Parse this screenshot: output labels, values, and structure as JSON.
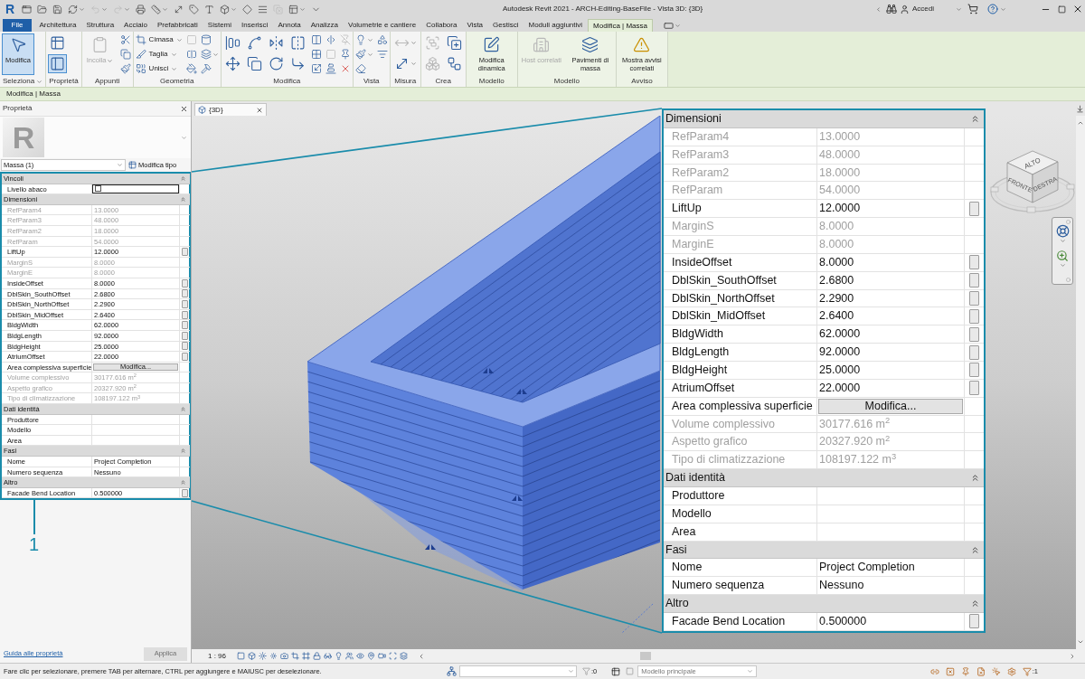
{
  "title_bar": {
    "logo": "R",
    "title": "Autodesk Revit 2021 - ARCH-Editing-BaseFile - Vista 3D: {3D}",
    "user": "Accedi"
  },
  "quick_access": [
    {
      "kind": "home",
      "disabled": false,
      "dropdown": false
    },
    {
      "kind": "open",
      "disabled": false,
      "dropdown": false
    },
    {
      "kind": "save",
      "disabled": false,
      "dropdown": false
    },
    {
      "kind": "sync",
      "disabled": false,
      "dropdown": true
    },
    {
      "kind": "undo",
      "disabled": true,
      "dropdown": true
    },
    {
      "kind": "redo",
      "disabled": true,
      "dropdown": true
    },
    {
      "kind": "print",
      "disabled": false,
      "dropdown": false
    },
    {
      "kind": "measure",
      "disabled": false,
      "dropdown": true
    },
    {
      "kind": "dimension",
      "disabled": false,
      "dropdown": false
    },
    {
      "kind": "tag",
      "disabled": false,
      "dropdown": false
    },
    {
      "kind": "text",
      "disabled": false,
      "dropdown": false
    },
    {
      "kind": "view3d",
      "disabled": false,
      "dropdown": true
    },
    {
      "kind": "section",
      "disabled": false,
      "dropdown": false
    },
    {
      "kind": "thinlines",
      "disabled": false,
      "dropdown": false
    },
    {
      "kind": "closewindows",
      "disabled": true,
      "dropdown": false
    },
    {
      "kind": "switchwindows",
      "disabled": false,
      "dropdown": true
    },
    {
      "kind": "customize",
      "disabled": false,
      "dropdown": false
    }
  ],
  "ribbon_tabs": [
    {
      "label": "File",
      "kind": "file",
      "selected": false
    },
    {
      "label": "Architettura",
      "kind": "tab",
      "selected": false
    },
    {
      "label": "Struttura",
      "kind": "tab",
      "selected": false
    },
    {
      "label": "Acciaio",
      "kind": "tab",
      "selected": false
    },
    {
      "label": "Prefabbricati",
      "kind": "tab",
      "selected": false
    },
    {
      "label": "Sistemi",
      "kind": "tab",
      "selected": false
    },
    {
      "label": "Inserisci",
      "kind": "tab",
      "selected": false
    },
    {
      "label": "Annota",
      "kind": "tab",
      "selected": false
    },
    {
      "label": "Analizza",
      "kind": "tab",
      "selected": false
    },
    {
      "label": "Volumetrie e cantiere",
      "kind": "tab",
      "selected": false
    },
    {
      "label": "Collabora",
      "kind": "tab",
      "selected": false
    },
    {
      "label": "Vista",
      "kind": "tab",
      "selected": false
    },
    {
      "label": "Gestisci",
      "kind": "tab",
      "selected": false
    },
    {
      "label": "Moduli aggiuntivi",
      "kind": "tab",
      "selected": false
    },
    {
      "label": "Modifica | Massa",
      "kind": "context",
      "selected": true
    }
  ],
  "ribbon_panels": [
    {
      "label": "Seleziona",
      "dropdown": true,
      "contextual": false,
      "large": [
        {
          "kind": "select",
          "label": "Modifica",
          "selected": true,
          "disabled": false,
          "dropdown": false
        }
      ]
    },
    {
      "label": "Proprietà",
      "dropdown": false,
      "contextual": false,
      "stacked": [
        {
          "kind": "type_properties",
          "selected": false,
          "disabled": false,
          "dropdown": false
        },
        {
          "kind": "properties",
          "selected": true,
          "disabled": false,
          "dropdown": false
        }
      ]
    },
    {
      "label": "Appunti",
      "dropdown": false,
      "contextual": false,
      "large": [
        {
          "kind": "paste",
          "label": "Incolla",
          "selected": false,
          "disabled": true,
          "dropdown": true
        }
      ],
      "small": [
        {
          "kind": "cut",
          "disabled": false,
          "dropdown": false
        },
        {
          "kind": "copy",
          "disabled": false,
          "dropdown": false
        },
        {
          "kind": "match",
          "disabled": false,
          "dropdown": false
        }
      ]
    },
    {
      "label": "Geometria",
      "dropdown": false,
      "contextual": false,
      "split": [
        {
          "kind": "cope",
          "label": "Cimasa"
        },
        {
          "kind": "slice",
          "label": "Taglia"
        },
        {
          "kind": "join",
          "label": "Unisci"
        }
      ],
      "small": [
        {
          "kind": "wall_joins",
          "disabled": true,
          "dropdown": false
        },
        {
          "kind": "split_face",
          "disabled": false,
          "dropdown": false
        },
        {
          "kind": "paint",
          "disabled": false,
          "dropdown": false
        },
        {
          "kind": "cylinder",
          "disabled": false,
          "dropdown": false
        },
        {
          "kind": "layers",
          "disabled": false,
          "dropdown": true
        },
        {
          "kind": "demolish",
          "disabled": false,
          "dropdown": false
        }
      ]
    },
    {
      "label": "Modifica",
      "dropdown": false,
      "contextual": false,
      "stacked": [
        {
          "kind": "align",
          "selected": false,
          "disabled": false,
          "dropdown": false
        },
        {
          "kind": "move",
          "selected": false,
          "disabled": false,
          "dropdown": false
        },
        {
          "kind": "offset",
          "selected": false,
          "disabled": false,
          "dropdown": false
        },
        {
          "kind": "copy_element",
          "selected": false,
          "disabled": false,
          "dropdown": false
        },
        {
          "kind": "mirror_axis",
          "selected": false,
          "disabled": false,
          "dropdown": false
        },
        {
          "kind": "rotate",
          "selected": false,
          "disabled": false,
          "dropdown": false
        },
        {
          "kind": "mirror_draw",
          "selected": false,
          "disabled": false,
          "dropdown": false
        },
        {
          "kind": "trim",
          "selected": false,
          "disabled": false,
          "dropdown": false
        }
      ],
      "small": [
        {
          "kind": "split",
          "disabled": false,
          "dropdown": false
        },
        {
          "kind": "array",
          "disabled": false,
          "dropdown": false
        },
        {
          "kind": "scale",
          "disabled": false,
          "dropdown": false
        },
        {
          "kind": "split_gap",
          "disabled": false,
          "dropdown": false
        },
        {
          "kind": "lock",
          "disabled": true,
          "dropdown": false
        },
        {
          "kind": "align_ends",
          "disabled": false,
          "dropdown": false
        },
        {
          "kind": "unpin",
          "disabled": true,
          "dropdown": false
        },
        {
          "kind": "pin",
          "disabled": false,
          "dropdown": false
        },
        {
          "kind": "delete",
          "disabled": false,
          "dropdown": false
        }
      ]
    },
    {
      "label": "Vista",
      "dropdown": false,
      "contextual": false,
      "small": [
        {
          "kind": "lightbulb",
          "disabled": false,
          "dropdown": true
        },
        {
          "kind": "view_paint",
          "disabled": false,
          "dropdown": true
        },
        {
          "kind": "linework",
          "disabled": false,
          "dropdown": false
        },
        {
          "kind": "override",
          "disabled": false,
          "dropdown": false
        },
        {
          "kind": "filter_lines",
          "disabled": false,
          "dropdown": false
        }
      ]
    },
    {
      "label": "Misura",
      "dropdown": false,
      "contextual": false,
      "stacked": [
        {
          "kind": "aligned_dimension",
          "selected": false,
          "disabled": true,
          "dropdown": true
        },
        {
          "kind": "measure_between",
          "selected": false,
          "disabled": false,
          "dropdown": true
        }
      ]
    },
    {
      "label": "Crea",
      "dropdown": false,
      "contextual": false,
      "stacked": [
        {
          "kind": "group",
          "selected": false,
          "disabled": true,
          "dropdown": false
        },
        {
          "kind": "parts",
          "selected": false,
          "disabled": true,
          "dropdown": false
        },
        {
          "kind": "create_similar",
          "selected": false,
          "disabled": false,
          "dropdown": false
        },
        {
          "kind": "assembly",
          "selected": false,
          "disabled": false,
          "dropdown": false
        }
      ]
    },
    {
      "label": "Modello",
      "dropdown": false,
      "contextual": true,
      "large": [
        {
          "kind": "dynamic_edit",
          "label": "Modifica dinamica",
          "selected": false,
          "disabled": false,
          "dropdown": false
        }
      ]
    },
    {
      "label": "Modello",
      "dropdown": false,
      "contextual": true,
      "large": [
        {
          "kind": "related_host",
          "label": "Host correlati",
          "selected": false,
          "disabled": true,
          "dropdown": false
        },
        {
          "kind": "mass_floors",
          "label": "Pavimenti di massa",
          "selected": false,
          "disabled": false,
          "dropdown": false
        }
      ]
    },
    {
      "label": "Avviso",
      "dropdown": false,
      "contextual": true,
      "large": [
        {
          "kind": "warnings",
          "label": "Mostra avvisi correlati",
          "selected": false,
          "disabled": false,
          "dropdown": false
        }
      ]
    }
  ],
  "context_bar": {
    "label": "Modifica | Massa"
  },
  "properties": {
    "title": "Proprietà",
    "type_image": "R",
    "type": "Massa (1)",
    "edit_type": "Modifica tipo",
    "help_link": "Guida alle proprietà",
    "apply": {
      "label": "Applica",
      "disabled": true
    },
    "groups": [
      {
        "name": "Vincoli",
        "expanded": true,
        "rows": [
          {
            "label": "Livello abaco",
            "kind": "select",
            "disabled": false,
            "param_button": false
          }
        ]
      },
      {
        "name": "Dimensioni",
        "expanded": true,
        "rows": [
          {
            "label": "RefParam4",
            "value": "13.0000",
            "kind": "text",
            "disabled": true,
            "param_button": false
          },
          {
            "label": "RefParam3",
            "value": "48.0000",
            "kind": "text",
            "disabled": true,
            "param_button": false
          },
          {
            "label": "RefParam2",
            "value": "18.0000",
            "kind": "text",
            "disabled": true,
            "param_button": false
          },
          {
            "label": "RefParam",
            "value": "54.0000",
            "kind": "text",
            "disabled": true,
            "param_button": false
          },
          {
            "label": "LiftUp",
            "value": "12.0000",
            "kind": "text",
            "disabled": false,
            "param_button": true
          },
          {
            "label": "MarginS",
            "value": "8.0000",
            "kind": "text",
            "disabled": true,
            "param_button": false
          },
          {
            "label": "MarginE",
            "value": "8.0000",
            "kind": "text",
            "disabled": true,
            "param_button": false
          },
          {
            "label": "InsideOffset",
            "value": "8.0000",
            "kind": "text",
            "disabled": false,
            "param_button": true
          },
          {
            "label": "DblSkin_SouthOffset",
            "value": "2.6800",
            "kind": "text",
            "disabled": false,
            "param_button": true
          },
          {
            "label": "DblSkin_NorthOffset",
            "value": "2.2900",
            "kind": "text",
            "disabled": false,
            "param_button": true
          },
          {
            "label": "DblSkin_MidOffset",
            "value": "2.6400",
            "kind": "text",
            "disabled": false,
            "param_button": true
          },
          {
            "label": "BldgWidth",
            "value": "62.0000",
            "kind": "text",
            "disabled": false,
            "param_button": true
          },
          {
            "label": "BldgLength",
            "value": "92.0000",
            "kind": "text",
            "disabled": false,
            "param_button": true
          },
          {
            "label": "BldgHeight",
            "value": "25.0000",
            "kind": "text",
            "disabled": false,
            "param_button": true
          },
          {
            "label": "AtriumOffset",
            "value": "22.0000",
            "kind": "text",
            "disabled": false,
            "param_button": true
          },
          {
            "label": "Area complessiva superficie",
            "value": "Modifica...",
            "kind": "button",
            "disabled": false,
            "param_button": false
          },
          {
            "label": "Volume complessivo",
            "value": "30177.616 m$^{2}$",
            "kind": "text",
            "disabled": true,
            "param_button": false
          },
          {
            "label": "Aspetto grafico",
            "value": "20327.920 m$^{2}$",
            "kind": "text",
            "disabled": true,
            "param_button": false
          },
          {
            "label": "Tipo di climatizzazione",
            "value": "108197.122 m$^{3}$",
            "kind": "text",
            "disabled": true,
            "param_button": false
          }
        ]
      },
      {
        "name": "Dati identità",
        "expanded": true,
        "rows": [
          {
            "label": "Produttore",
            "kind": "text",
            "disabled": false,
            "param_button": false
          },
          {
            "label": "Modello",
            "kind": "text",
            "disabled": false,
            "param_button": false
          },
          {
            "label": "Area",
            "kind": "text",
            "disabled": false,
            "param_button": false
          }
        ]
      },
      {
        "name": "Fasi",
        "expanded": true,
        "rows": [
          {
            "label": "Nome",
            "value": "Project Completion",
            "kind": "text",
            "disabled": false,
            "param_button": false
          },
          {
            "label": "Numero sequenza",
            "value": "Nessuno",
            "kind": "text",
            "disabled": false,
            "param_button": false
          }
        ]
      },
      {
        "name": "Altro",
        "expanded": true,
        "rows": [
          {
            "label": "Facade Bend Location",
            "value": "0.500000",
            "kind": "text",
            "disabled": false,
            "param_button": true
          }
        ]
      }
    ]
  },
  "view": {
    "tab": "{3D}",
    "scale": "1 : 96",
    "view_cube": [
      "ALTO",
      "FRONTE",
      "DESTRA"
    ]
  },
  "callout": {
    "number": "1",
    "groups": [
      {
        "name": "Dimensioni",
        "expanded": true,
        "rows": [
          {
            "label": "RefParam4",
            "value": "13.0000",
            "kind": "text",
            "disabled": true,
            "param_button": false
          },
          {
            "label": "RefParam3",
            "value": "48.0000",
            "kind": "text",
            "disabled": true,
            "param_button": false
          },
          {
            "label": "RefParam2",
            "value": "18.0000",
            "kind": "text",
            "disabled": true,
            "param_button": false
          },
          {
            "label": "RefParam",
            "value": "54.0000",
            "kind": "text",
            "disabled": true,
            "param_button": false
          },
          {
            "label": "LiftUp",
            "value": "12.0000",
            "kind": "text",
            "disabled": false,
            "param_button": true
          },
          {
            "label": "MarginS",
            "value": "8.0000",
            "kind": "text",
            "disabled": true,
            "param_button": false
          },
          {
            "label": "MarginE",
            "value": "8.0000",
            "kind": "text",
            "disabled": true,
            "param_button": false
          },
          {
            "label": "InsideOffset",
            "value": "8.0000",
            "kind": "text",
            "disabled": false,
            "param_button": true
          },
          {
            "label": "DblSkin_SouthOffset",
            "value": "2.6800",
            "kind": "text",
            "disabled": false,
            "param_button": true
          },
          {
            "label": "DblSkin_NorthOffset",
            "value": "2.2900",
            "kind": "text",
            "disabled": false,
            "param_button": true
          },
          {
            "label": "DblSkin_MidOffset",
            "value": "2.6400",
            "kind": "text",
            "disabled": false,
            "param_button": true
          },
          {
            "label": "BldgWidth",
            "value": "62.0000",
            "kind": "text",
            "disabled": false,
            "param_button": true
          },
          {
            "label": "BldgLength",
            "value": "92.0000",
            "kind": "text",
            "disabled": false,
            "param_button": true
          },
          {
            "label": "BldgHeight",
            "value": "25.0000",
            "kind": "text",
            "disabled": false,
            "param_button": true
          },
          {
            "label": "AtriumOffset",
            "value": "22.0000",
            "kind": "text",
            "disabled": false,
            "param_button": true
          },
          {
            "label": "Area complessiva superficie",
            "value": "Modifica...",
            "kind": "button",
            "disabled": false,
            "param_button": false
          },
          {
            "label": "Volume complessivo",
            "value": "30177.616 m$^{2}$",
            "kind": "text",
            "disabled": true,
            "param_button": false
          },
          {
            "label": "Aspetto grafico",
            "value": "20327.920 m$^{2}$",
            "kind": "text",
            "disabled": true,
            "param_button": false
          },
          {
            "label": "Tipo di climatizzazione",
            "value": "108197.122 m$^{3}$",
            "kind": "text",
            "disabled": true,
            "param_button": false
          }
        ]
      },
      {
        "name": "Dati identità",
        "expanded": true,
        "rows": [
          {
            "label": "Produttore",
            "kind": "text",
            "disabled": false,
            "param_button": false
          },
          {
            "label": "Modello",
            "kind": "text",
            "disabled": false,
            "param_button": false
          },
          {
            "label": "Area",
            "kind": "text",
            "disabled": false,
            "param_button": false
          }
        ]
      },
      {
        "name": "Fasi",
        "expanded": true,
        "rows": [
          {
            "label": "Nome",
            "value": "Project Completion",
            "kind": "text",
            "disabled": false,
            "param_button": false
          },
          {
            "label": "Numero sequenza",
            "value": "Nessuno",
            "kind": "text",
            "disabled": false,
            "param_button": false
          }
        ]
      },
      {
        "name": "Altro",
        "expanded": true,
        "rows": [
          {
            "label": "Facade Bend Location",
            "value": "0.500000",
            "kind": "text",
            "disabled": false,
            "param_button": true
          }
        ]
      }
    ]
  },
  "status_bar": {
    "message": "Fare clic per selezionare, premere TAB per alternare, CTRL per aggiungere e MAIUSC per deselezionare.",
    "editable_count": ":0",
    "model": "Modello principale",
    "filter_count": ":1"
  }
}
